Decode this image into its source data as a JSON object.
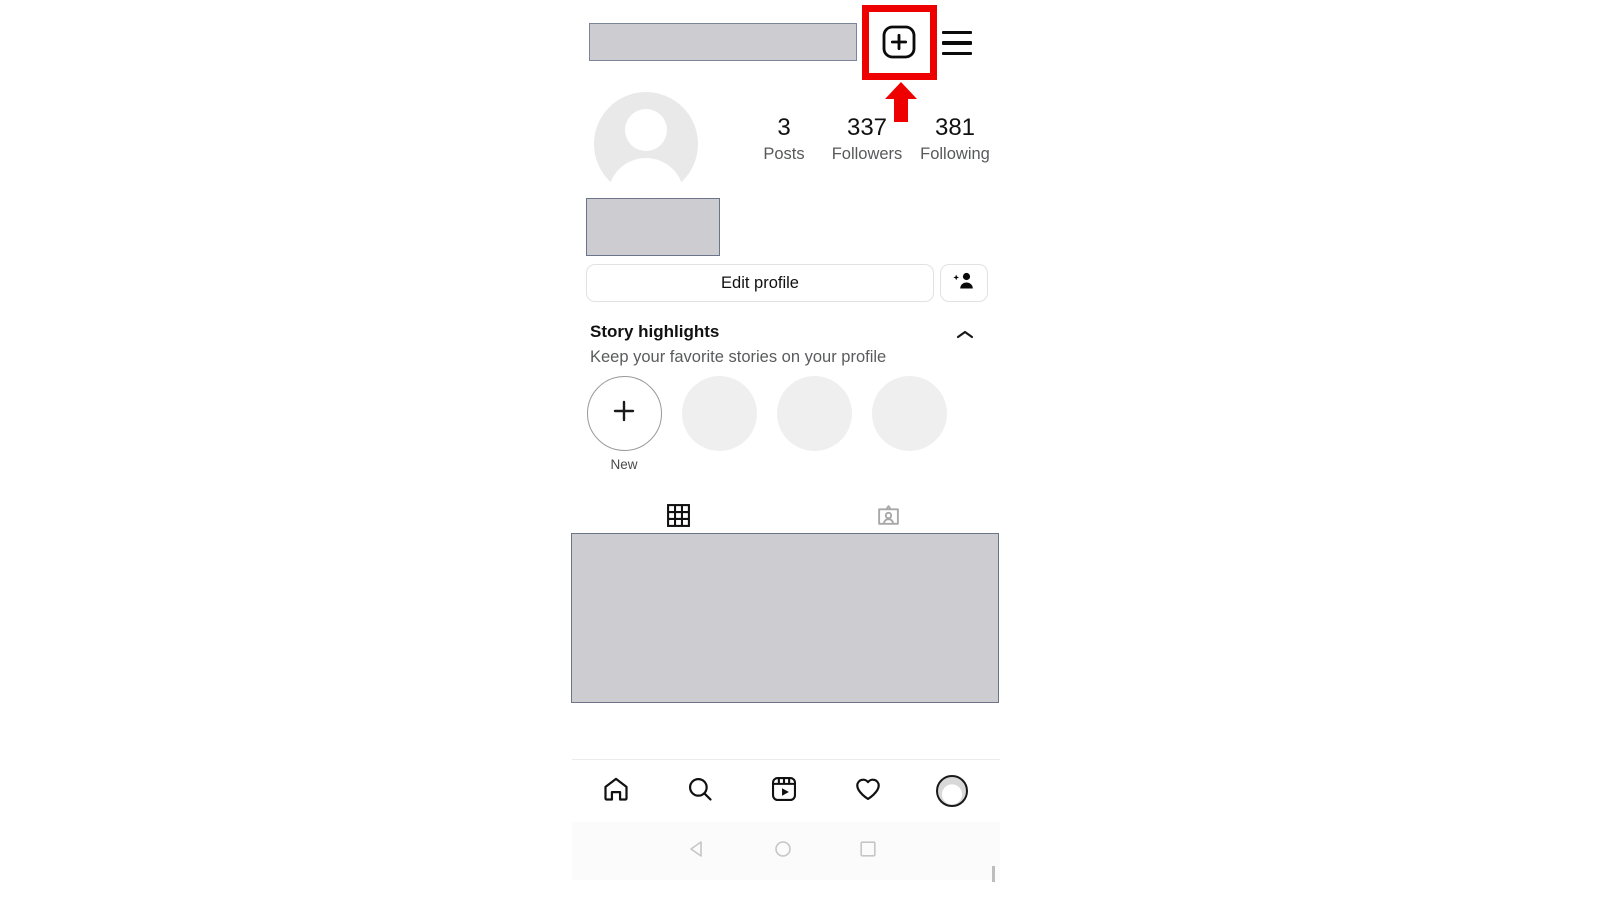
{
  "app": {
    "name": "Instagram",
    "screen": "profile"
  },
  "topbar": {
    "username_redacted": true,
    "new_post_icon": "plus-square-icon",
    "menu_icon": "hamburger-icon",
    "highlight_color": "#ee0000",
    "annotation": "red-arrow-pointing-to-new-post-button"
  },
  "profile": {
    "avatar_icon": "default-avatar-icon",
    "bio_redacted": true,
    "stats": [
      {
        "key": "posts",
        "value": "3",
        "label": "Posts"
      },
      {
        "key": "followers",
        "value": "337",
        "label": "Followers"
      },
      {
        "key": "following",
        "value": "381",
        "label": "Following"
      }
    ]
  },
  "actions": {
    "edit_profile_label": "Edit profile",
    "add_person_icon": "add-person-icon"
  },
  "story_highlights": {
    "title": "Story highlights",
    "subtitle": "Keep your favorite stories on your profile",
    "collapse_icon": "chevron-up-icon",
    "items": [
      {
        "type": "new",
        "label": "New",
        "icon": "plus-icon"
      },
      {
        "type": "placeholder",
        "label": ""
      },
      {
        "type": "placeholder",
        "label": ""
      },
      {
        "type": "placeholder",
        "label": ""
      }
    ]
  },
  "tabs": [
    {
      "key": "grid",
      "icon": "grid-icon",
      "active": true
    },
    {
      "key": "tagged",
      "icon": "tagged-photos-icon",
      "active": false
    }
  ],
  "content": {
    "redacted": true
  },
  "bottom_nav": [
    {
      "key": "home",
      "icon": "home-icon",
      "active": false
    },
    {
      "key": "search",
      "icon": "search-icon",
      "active": false
    },
    {
      "key": "reels",
      "icon": "reels-icon",
      "active": false
    },
    {
      "key": "activity",
      "icon": "heart-icon",
      "active": false
    },
    {
      "key": "profile",
      "icon": "profile-avatar-icon",
      "active": true
    }
  ],
  "system_nav": [
    {
      "key": "back",
      "icon": "back-triangle-icon"
    },
    {
      "key": "home",
      "icon": "home-circle-icon"
    },
    {
      "key": "recents",
      "icon": "recents-square-icon"
    }
  ],
  "colors": {
    "accent_highlight": "#ee0000",
    "redaction_fill": "#cdcdd1",
    "redaction_border": "#6c7489",
    "text_primary": "#111111",
    "text_secondary": "#58595b",
    "placeholder_circle": "#efefef"
  }
}
